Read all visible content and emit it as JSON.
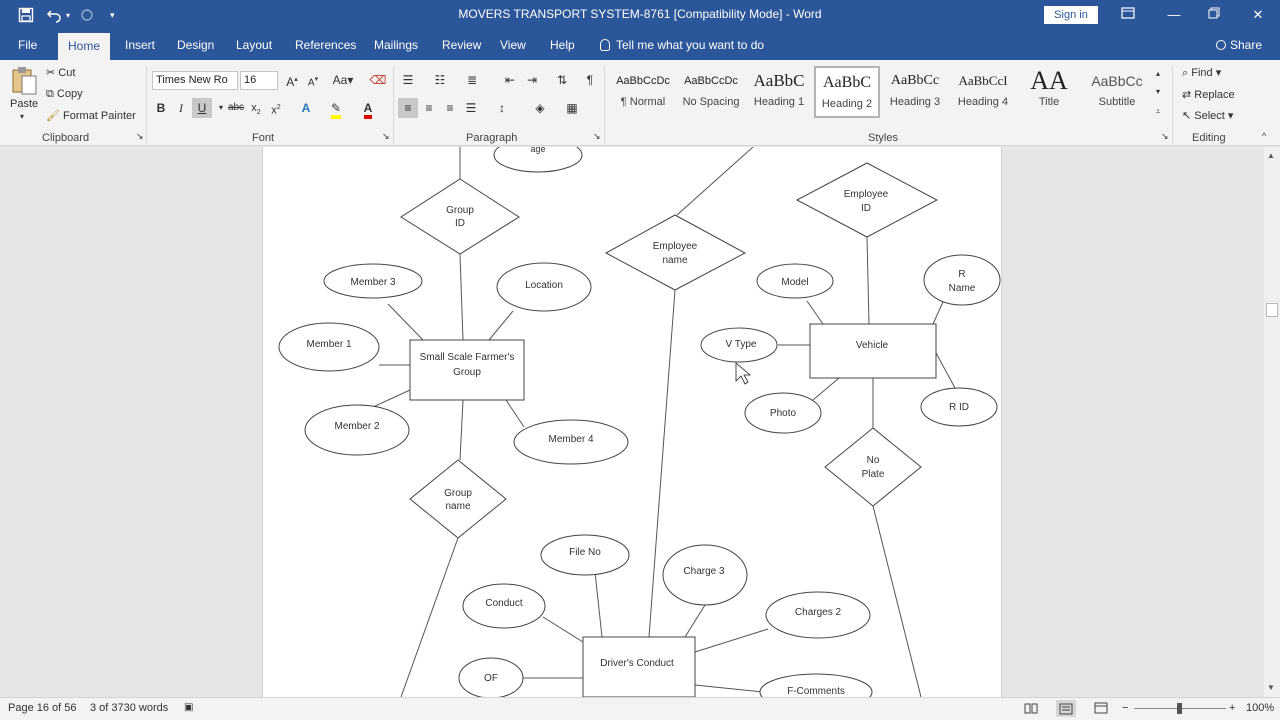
{
  "window": {
    "title": "MOVERS TRANSPORT SYSTEM-8761 [Compatibility Mode]  -  Word",
    "sign_in": "Sign in"
  },
  "tabs": [
    {
      "label": "File"
    },
    {
      "label": "Home"
    },
    {
      "label": "Insert"
    },
    {
      "label": "Design"
    },
    {
      "label": "Layout"
    },
    {
      "label": "References"
    },
    {
      "label": "Mailings"
    },
    {
      "label": "Review"
    },
    {
      "label": "View"
    },
    {
      "label": "Help"
    },
    {
      "label": "Tell me what you want to do"
    },
    {
      "label": "Share"
    }
  ],
  "clipboard": {
    "paste": "Paste",
    "cut": "Cut",
    "copy": "Copy",
    "format_painter": "Format Painter",
    "label": "Clipboard"
  },
  "font": {
    "name": "Times New Ro",
    "size": "16",
    "label": "Font"
  },
  "paragraph": {
    "label": "Paragraph"
  },
  "styles": {
    "label": "Styles",
    "items": [
      {
        "sample": "AaBbCcDc",
        "name": "¶ Normal"
      },
      {
        "sample": "AaBbCcDc",
        "name": "No Spacing"
      },
      {
        "sample": "AaBbC",
        "name": "Heading 1"
      },
      {
        "sample": "AaBbC",
        "name": "Heading 2"
      },
      {
        "sample": "AaBbCc",
        "name": "Heading 3"
      },
      {
        "sample": "AaBbCcI",
        "name": "Heading 4"
      },
      {
        "sample": "AA",
        "name": "Title"
      },
      {
        "sample": "AaBbCc",
        "name": "Subtitle"
      }
    ]
  },
  "editing": {
    "find": "Find",
    "replace": "Replace",
    "select": "Select",
    "label": "Editing"
  },
  "diagram": {
    "entities": [
      "Small Scale Farmer's",
      "Group",
      "Vehicle",
      "Driver's Conduct"
    ],
    "attributes": [
      "age",
      "Member 3",
      "Location",
      "Member 1",
      "Member 2",
      "Member 4",
      "Model",
      "R",
      "Name",
      "V Type",
      "Photo",
      "R ID",
      "File No",
      "Charge 3",
      "Conduct",
      "Charges 2",
      "OF",
      "F-Comments"
    ],
    "relationships": [
      "Group",
      "ID",
      "Employee",
      "name",
      "Employee",
      "ID",
      "Group",
      "name",
      "No",
      "Plate"
    ]
  },
  "status": {
    "page": "Page 16 of 56",
    "words": "3 of 3730 words",
    "zoom": "100%"
  },
  "colors": {
    "brand": "#2b579a",
    "ribbon": "#f3f3f3"
  }
}
